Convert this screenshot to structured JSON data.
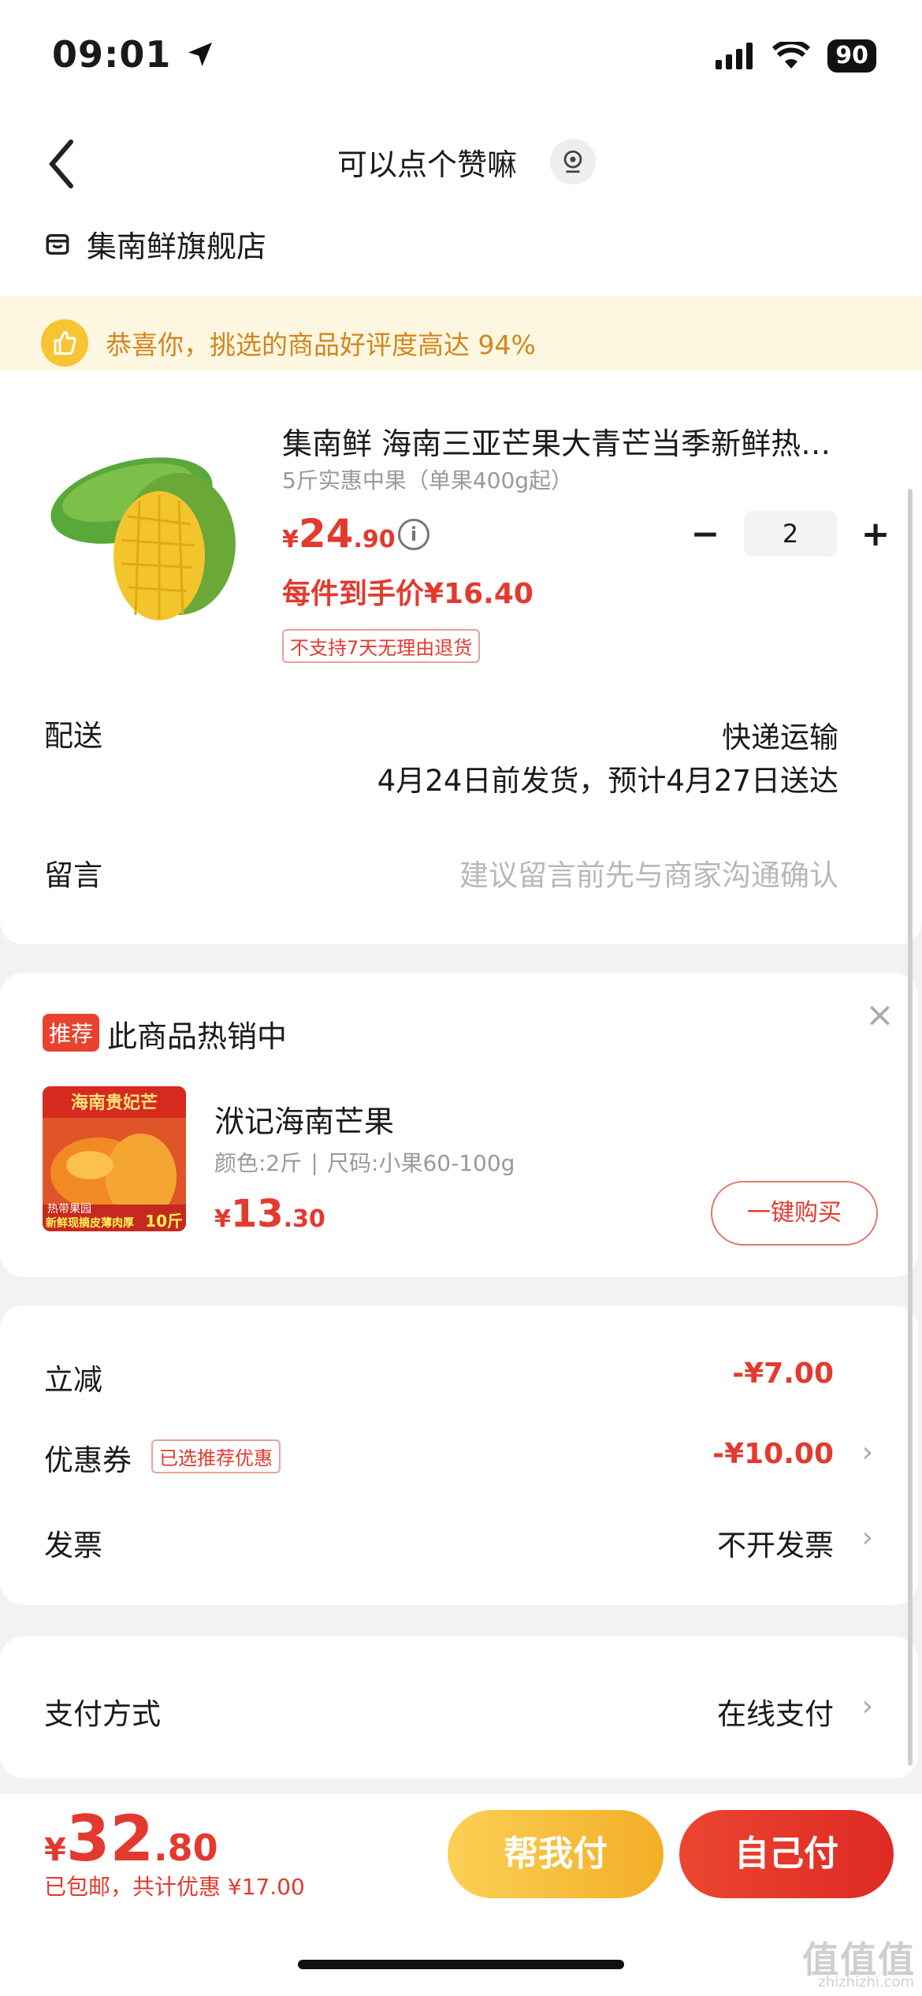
{
  "status": {
    "time": "09:01",
    "battery": "90"
  },
  "header": {
    "title": "可以点个赞嘛",
    "store": "集南鲜旗舰店"
  },
  "banner": {
    "text": "恭喜你，挑选的商品好评度高达 94%"
  },
  "product": {
    "title": "集南鲜   海南三亚芒果大青芒当季新鲜热…",
    "spec": "5斤实惠中果（单果400g起）",
    "price_symbol": "¥",
    "price_int": "24",
    "price_dec": ".90",
    "quantity": "2",
    "final_price": "每件到手价¥16.40",
    "no_return": "不支持7天无理由退货"
  },
  "delivery": {
    "label": "配送",
    "method": "快递运输",
    "time": "4月24日前发货，预计4月27日送达"
  },
  "message": {
    "label": "留言",
    "placeholder": "建议留言前先与商家沟通确认"
  },
  "recommend": {
    "tag": "推荐",
    "title": "此商品热销中",
    "name": "洑记海南芒果",
    "spec": "颜色:2斤  ∣  尺码:小果60-100g",
    "price_symbol": "¥",
    "price_int": "13",
    "price_dec": ".30",
    "buy_label": "一键购买",
    "img_top": "海南贵妃芒",
    "img_mid": "热带果园",
    "img_bottom": "新鲜现摘皮薄肉厚",
    "img_weight": "10斤"
  },
  "discounts": {
    "instant_label": "立减",
    "instant_value": "-¥7.00",
    "coupon_label": "优惠券",
    "coupon_tag": "已选推荐优惠",
    "coupon_value": "-¥10.00",
    "invoice_label": "发票",
    "invoice_value": "不开发票"
  },
  "payment": {
    "label": "支付方式",
    "value": "在线支付"
  },
  "bottom": {
    "total_symbol": "¥",
    "total_int": "32",
    "total_dec": ".80",
    "sub": "已包邮，共计优惠 ¥17.00",
    "help_pay": "帮我付",
    "self_pay": "自己付"
  },
  "watermark": {
    "main": "值值值",
    "sub": "zhizhizhi.com"
  },
  "colors": {
    "accent_red": "#e33a2f",
    "banner_bg": "#fdf6e0",
    "help_btn": "#f3ae27"
  }
}
